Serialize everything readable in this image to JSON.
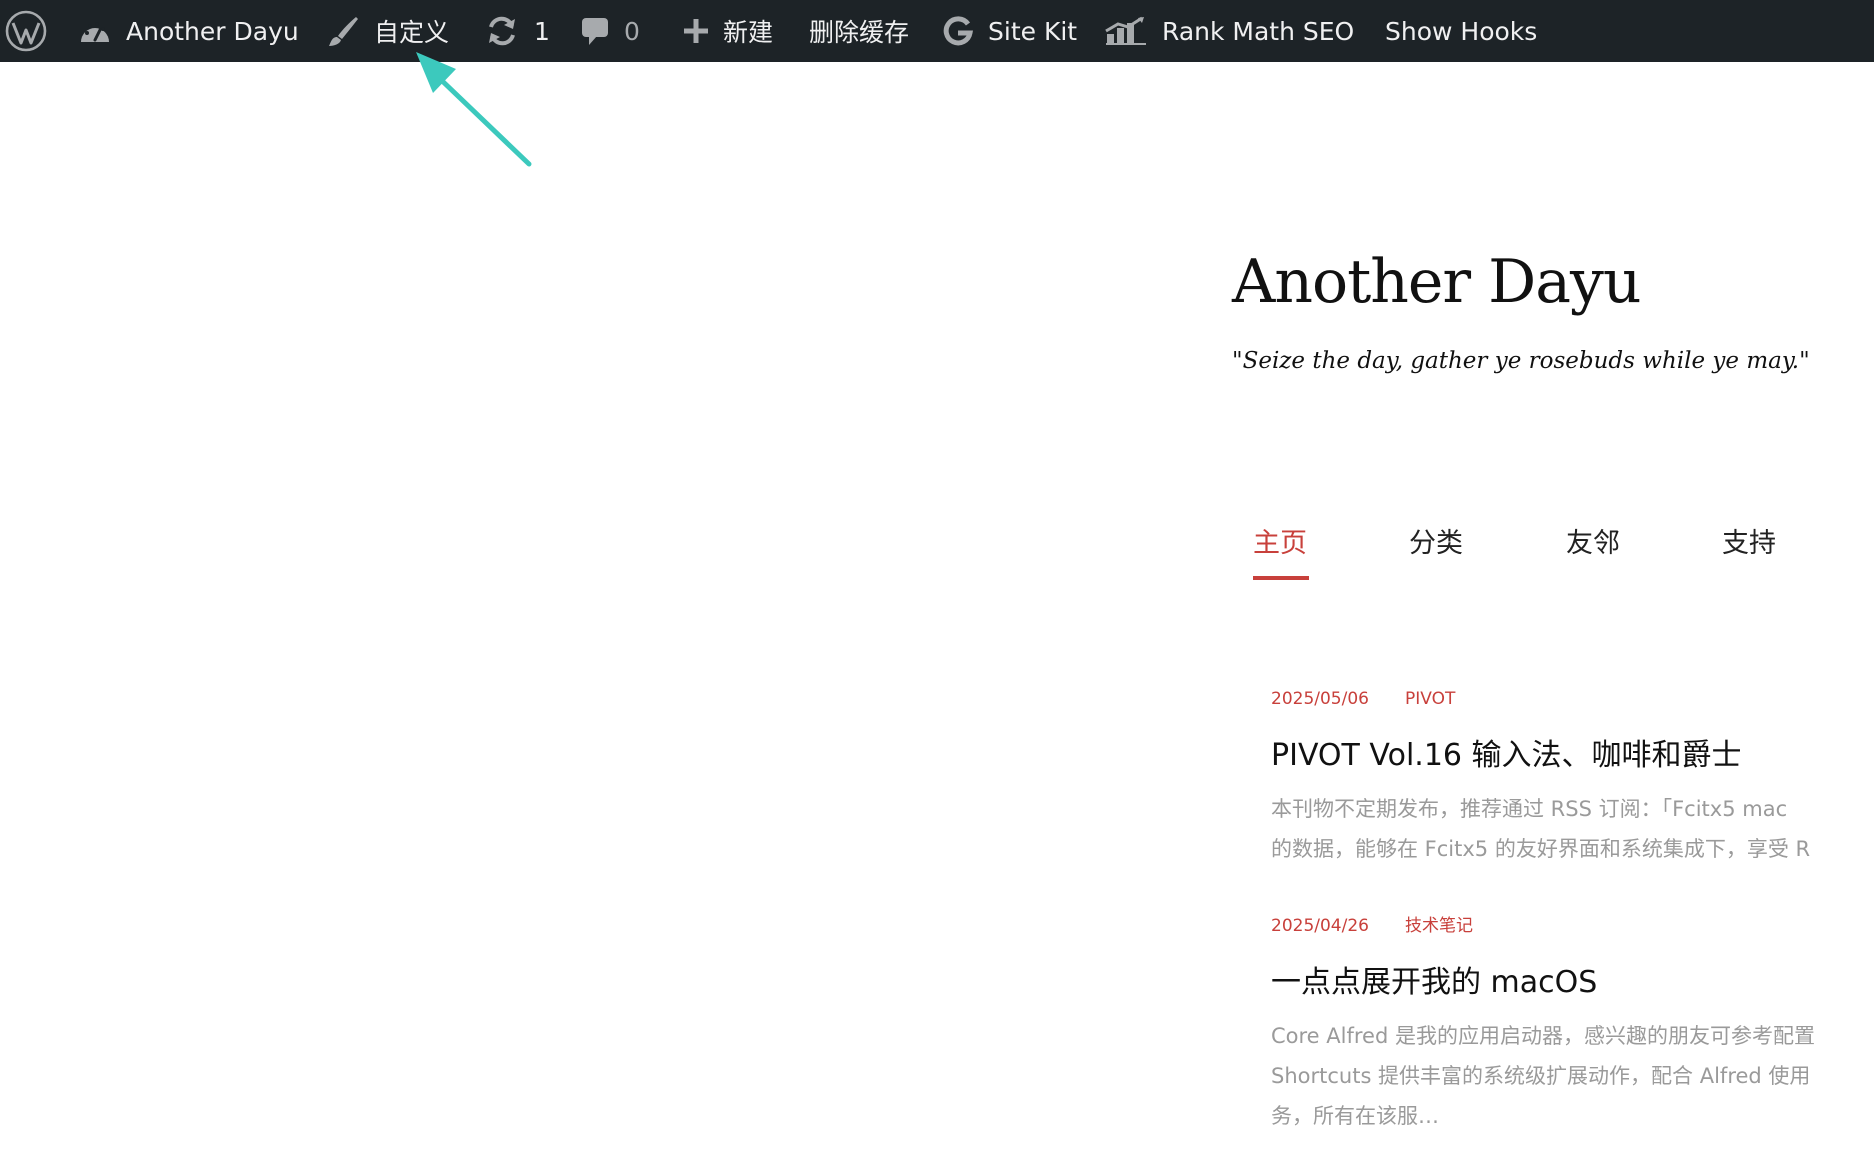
{
  "adminbar": {
    "wp_logo_icon": "wordpress-icon",
    "site_name": "Another Dayu",
    "site_icon": "dashboard-icon",
    "customize_label": "自定义",
    "customize_icon": "brush-icon",
    "updates_count": "1",
    "updates_icon": "updates-icon",
    "comments_count": "0",
    "comments_icon": "comment-icon",
    "new_label": "新建",
    "new_icon": "plus-icon",
    "clear_cache_label": "删除缓存",
    "sitekit_label": "Site Kit",
    "sitekit_icon": "google-icon",
    "rankmath_label": "Rank Math SEO",
    "rankmath_icon": "rank-math-icon",
    "show_hooks_label": "Show Hooks"
  },
  "header": {
    "title": "Another Dayu",
    "tagline": "\"Seize the day, gather ye rosebuds while ye may.\""
  },
  "nav": {
    "items": [
      {
        "label": "主页",
        "active": true
      },
      {
        "label": "分类",
        "active": false
      },
      {
        "label": "友邻",
        "active": false
      },
      {
        "label": "支持",
        "active": false
      }
    ]
  },
  "posts": [
    {
      "date": "2025/05/06",
      "category": "PIVOT",
      "title": "PIVOT Vol.16 输入法、咖啡和爵士",
      "excerpt_lines": [
        "本刊物不定期发布，推荐通过 RSS 订阅：「Fcitx5 mac",
        "的数据，能够在 Fcitx5 的友好界面和系统集成下，享受 R"
      ]
    },
    {
      "date": "2025/04/26",
      "category": "技术笔记",
      "title": "一点点展开我的 macOS",
      "excerpt_lines": [
        "Core Alfred 是我的应用启动器，感兴趣的朋友可参考配置",
        "Shortcuts 提供丰富的系统级扩展动作，配合 Alfred 使用",
        "务，所有在该服…"
      ]
    }
  ],
  "colors": {
    "adminbar_bg": "#1d2327",
    "accent": "#c8403b",
    "annotation_arrow": "#3cc9bd"
  }
}
